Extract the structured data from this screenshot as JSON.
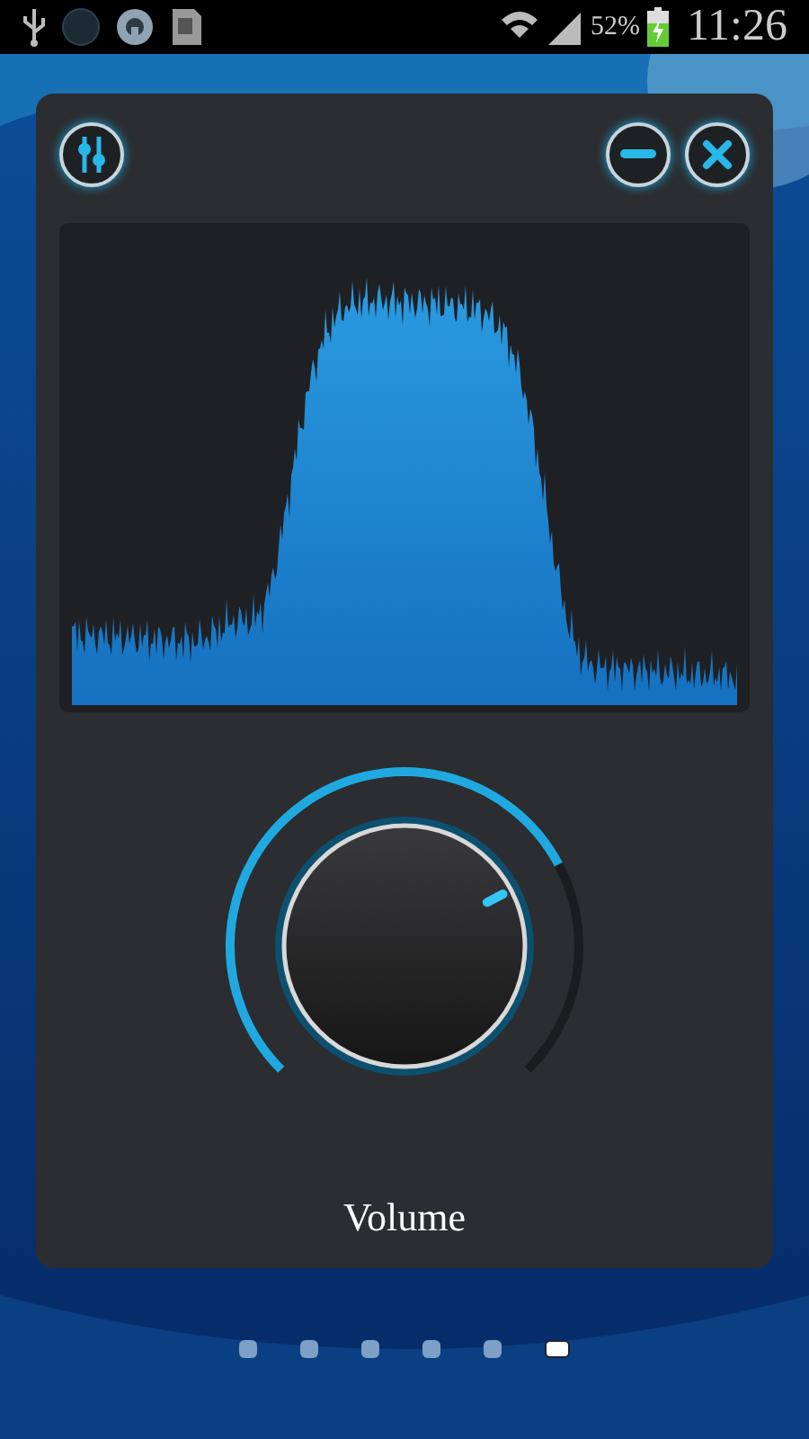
{
  "status_bar": {
    "battery_text": "52%",
    "time": "11:26"
  },
  "volume": {
    "label": "Volume"
  },
  "pages": [
    {
      "selected": false
    },
    {
      "selected": false
    },
    {
      "selected": false
    },
    {
      "selected": false
    },
    {
      "selected": false
    },
    {
      "selected": true
    }
  ]
}
